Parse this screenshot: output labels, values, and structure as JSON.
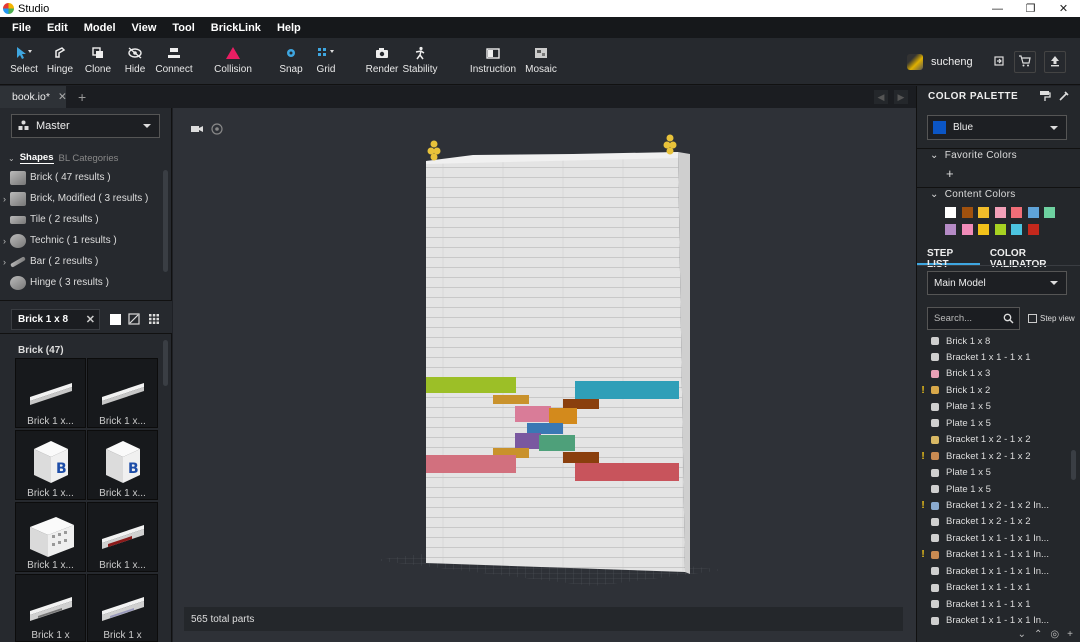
{
  "window": {
    "title": "Studio",
    "controls": [
      "—",
      "❐",
      "✕"
    ]
  },
  "menu": [
    "File",
    "Edit",
    "Model",
    "View",
    "Tool",
    "BrickLink",
    "Help"
  ],
  "toolbar": {
    "tools": [
      {
        "label": "Select",
        "icon": "select-icon"
      },
      {
        "label": "Hinge",
        "icon": "hinge-icon"
      },
      {
        "label": "Clone",
        "icon": "clone-icon"
      },
      {
        "label": "Hide",
        "icon": "hide-icon"
      },
      {
        "label": "Connect",
        "icon": "connect-icon"
      },
      {
        "label": "Collision",
        "icon": "collision-icon"
      },
      {
        "label": "Snap",
        "icon": "snap-icon"
      },
      {
        "label": "Grid",
        "icon": "grid-icon"
      },
      {
        "label": "Render",
        "icon": "render-icon"
      },
      {
        "label": "Stability",
        "icon": "stability-icon"
      },
      {
        "label": "Instruction",
        "icon": "instruction-icon"
      },
      {
        "label": "Mosaic",
        "icon": "mosaic-icon"
      }
    ],
    "username": "sucheng"
  },
  "tabs": {
    "active": "book.io*",
    "close": "✕",
    "add": "+"
  },
  "left": {
    "master": "Master",
    "subtabs": [
      "Shapes",
      "BL Categories"
    ],
    "categories": [
      {
        "label": "Brick ( 47 results )",
        "expand": ""
      },
      {
        "label": "Brick, Modified ( 3 results )",
        "expand": "›"
      },
      {
        "label": "Tile ( 2 results )",
        "expand": ""
      },
      {
        "label": "Technic ( 1 results )",
        "expand": "›"
      },
      {
        "label": "Bar ( 2 results )",
        "expand": "›"
      },
      {
        "label": "Hinge ( 3 results )",
        "expand": ""
      }
    ],
    "search_value": "Brick 1 x 8",
    "group_label": "Brick (47)",
    "parts": [
      "Brick 1 x...",
      "Brick 1 x...",
      "Brick 1 x...",
      "Brick 1 x...",
      "Brick 1 x...",
      "Brick 1 x...",
      "Brick 1 x",
      "Brick 1 x"
    ]
  },
  "viewport": {
    "status": "565 total parts"
  },
  "right": {
    "palette_title": "COLOR PALETTE",
    "selected_color": "Blue",
    "selected_color_hex": "#0b55c4",
    "favorite_colors": "Favorite Colors",
    "add": "+",
    "content_colors": "Content Colors",
    "swatches": [
      "#ffffff",
      "#a0510e",
      "#f2bd2a",
      "#f2a0b8",
      "#f06e78",
      "#5fa3d8",
      "#6ed1a0",
      "#b58bc6",
      "#f08bb8",
      "#f2c21a",
      "#a7d222",
      "#4cc4e0",
      "#c4281c"
    ],
    "tabs": [
      "STEP LIST",
      "COLOR VALIDATOR"
    ],
    "model": "Main Model",
    "search_placeholder": "Search...",
    "step_view": "Step view",
    "steps": [
      {
        "label": "Brick 1 x 8",
        "warn": "",
        "color": "#cfcfcf"
      },
      {
        "label": "Bracket 1 x 1 - 1 x 1",
        "warn": "",
        "color": "#cfcfcf"
      },
      {
        "label": "Brick 1 x 3",
        "warn": "",
        "color": "#e9a0b6"
      },
      {
        "label": "Brick 1 x 2",
        "warn": "!",
        "color": "#d8a84a"
      },
      {
        "label": "Plate 1 x 5",
        "warn": "",
        "color": "#cfcfcf"
      },
      {
        "label": "Plate 1 x 5",
        "warn": "",
        "color": "#cfcfcf"
      },
      {
        "label": "Bracket 1 x 2 - 1 x 2",
        "warn": "",
        "color": "#d8b864"
      },
      {
        "label": "Bracket 1 x 2 - 1 x 2",
        "warn": "!",
        "color": "#c88a52"
      },
      {
        "label": "Plate 1 x 5",
        "warn": "",
        "color": "#cfcfcf"
      },
      {
        "label": "Plate 1 x 5",
        "warn": "",
        "color": "#cfcfcf"
      },
      {
        "label": "Bracket 1 x 2 - 1 x 2 In...",
        "warn": "!",
        "color": "#8aaad0"
      },
      {
        "label": "Bracket 1 x 2 - 1 x 2",
        "warn": "",
        "color": "#cfcfcf"
      },
      {
        "label": "Bracket 1 x 1 - 1 x 1 In...",
        "warn": "",
        "color": "#cfcfcf"
      },
      {
        "label": "Bracket 1 x 1 - 1 x 1 In...",
        "warn": "!",
        "color": "#c88a52"
      },
      {
        "label": "Bracket 1 x 1 - 1 x 1 In...",
        "warn": "",
        "color": "#cfcfcf"
      },
      {
        "label": "Bracket 1 x 1 - 1 x 1",
        "warn": "",
        "color": "#cfcfcf"
      },
      {
        "label": "Bracket 1 x 1 - 1 x 1",
        "warn": "",
        "color": "#cfcfcf"
      },
      {
        "label": "Bracket 1 x 1 - 1 x 1 In...",
        "warn": "",
        "color": "#cfcfcf"
      }
    ]
  }
}
